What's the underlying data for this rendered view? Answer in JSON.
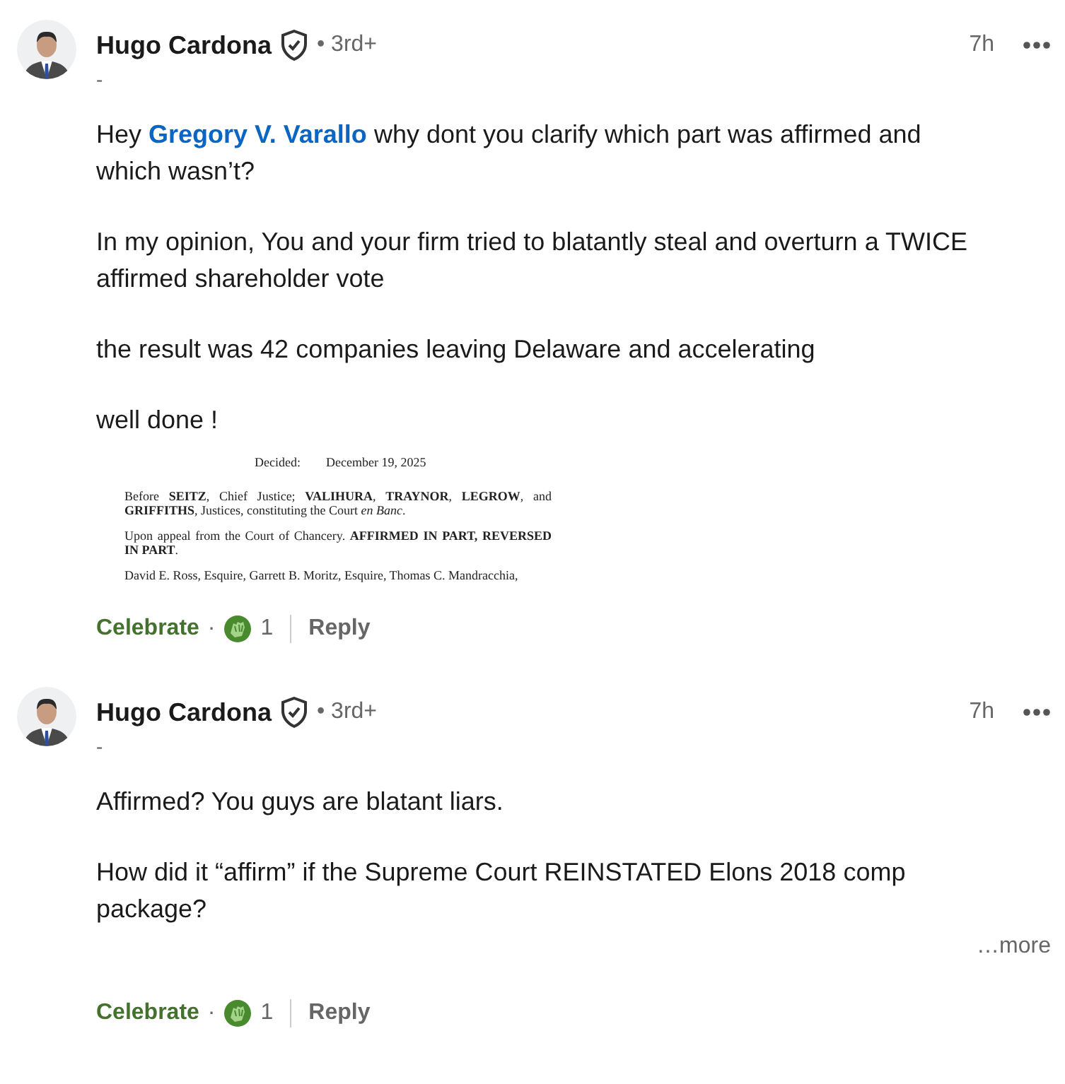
{
  "comments": [
    {
      "author": "Hugo Cardona",
      "degree": "• 3rd+",
      "headline": "-",
      "time": "7h",
      "paragraphs": [
        {
          "before": "Hey ",
          "mention": "Gregory V. Varallo",
          "after": " why dont you clarify which part was affirmed and which wasn’t?"
        },
        {
          "before": "In my opinion, You and your firm tried to blatantly steal and overturn a TWICE affirmed shareholder vote"
        },
        {
          "before": "the result was 42 companies leaving Delaware and accelerating"
        },
        {
          "before": "well done !"
        }
      ],
      "document": {
        "decided_label": "Decided:",
        "decided_date": "December 19, 2025",
        "lines": [
          "Before **SEITZ**, Chief Justice; **VALIHURA**, **TRAYNOR**, **LEGROW**, and **GRIFFITHS**, Justices, constituting the Court *en Banc*.",
          "Upon appeal from the Court of Chancery.  **AFFIRMED IN PART, REVERSED IN PART**.",
          "David E. Ross, Esquire, Garrett B. Moritz, Esquire, Thomas C. Mandracchia,"
        ]
      },
      "reaction": {
        "label": "Celebrate",
        "selected": true,
        "separator": "·",
        "count": "1"
      },
      "reply": "Reply"
    },
    {
      "author": "Hugo Cardona",
      "degree": "• 3rd+",
      "headline": "-",
      "time": "7h",
      "paragraphs": [
        {
          "before": "Affirmed? You guys are blatant liars."
        },
        {
          "before": "How did it “affirm” if the Supreme Court REINSTATED Elons 2018 comp package?"
        }
      ],
      "more": "…more",
      "reaction": {
        "label": "Celebrate",
        "selected": true,
        "separator": "·",
        "count": "1"
      },
      "reply": "Reply"
    }
  ]
}
